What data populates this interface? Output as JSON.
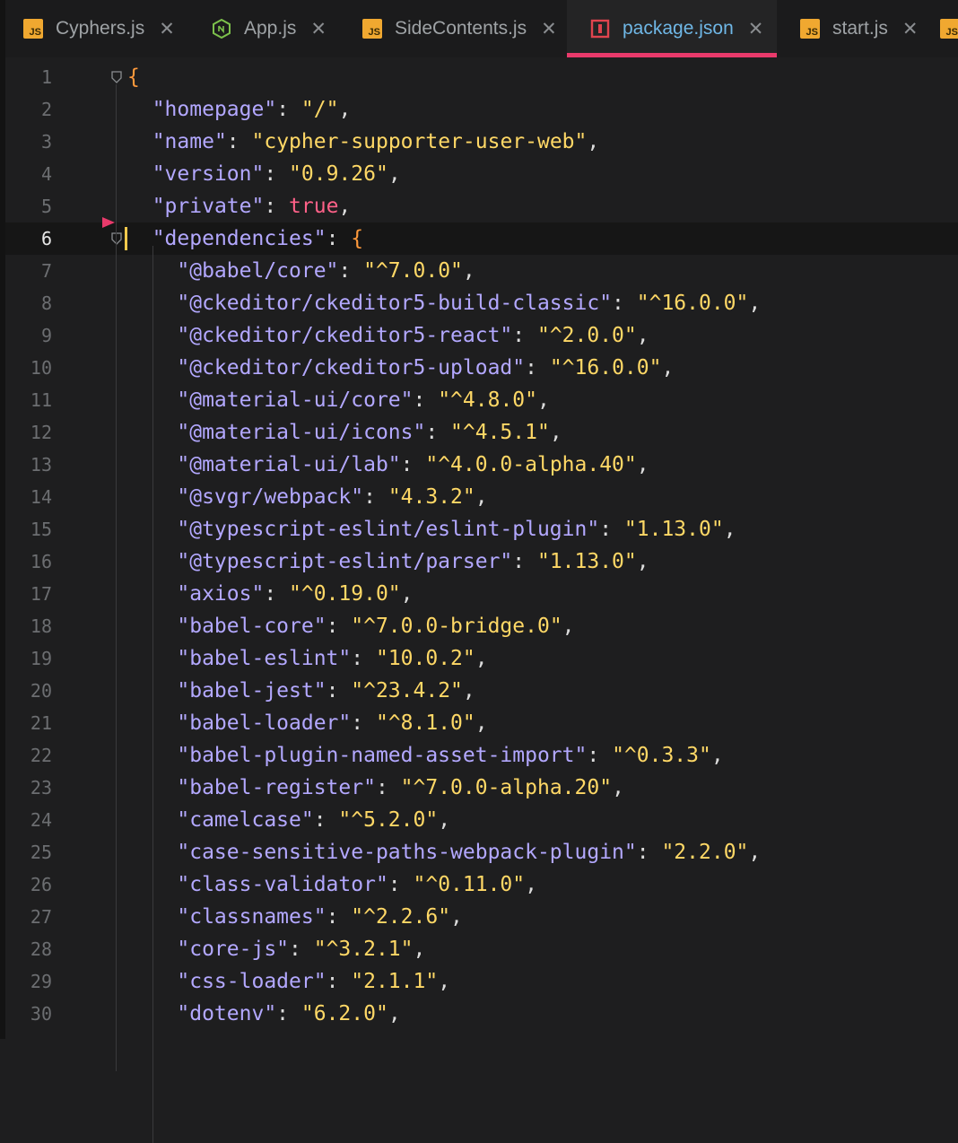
{
  "tabs": [
    {
      "label": "Cyphers.js",
      "icon": "js-icon",
      "active": false
    },
    {
      "label": "App.js",
      "icon": "nodejs-icon",
      "active": false
    },
    {
      "label": "SideContents.js",
      "icon": "js-icon",
      "active": false
    },
    {
      "label": "package.json",
      "icon": "npm-icon",
      "active": true
    },
    {
      "label": "start.js",
      "icon": "js-icon",
      "active": false
    }
  ],
  "close_glyph": "✕",
  "js_badge_text": "JS",
  "current_line": 6,
  "lines": [
    {
      "n": "1",
      "tokens": [
        {
          "t": "brace",
          "v": "{"
        }
      ]
    },
    {
      "n": "2",
      "tokens": [
        {
          "t": "ind",
          "v": "  "
        },
        {
          "t": "key",
          "v": "\"homepage\""
        },
        {
          "t": "punct",
          "v": ": "
        },
        {
          "t": "str",
          "v": "\"/\""
        },
        {
          "t": "punct",
          "v": ","
        }
      ]
    },
    {
      "n": "3",
      "tokens": [
        {
          "t": "ind",
          "v": "  "
        },
        {
          "t": "key",
          "v": "\"name\""
        },
        {
          "t": "punct",
          "v": ": "
        },
        {
          "t": "str",
          "v": "\"cypher-supporter-user-web\""
        },
        {
          "t": "punct",
          "v": ","
        }
      ]
    },
    {
      "n": "4",
      "tokens": [
        {
          "t": "ind",
          "v": "  "
        },
        {
          "t": "key",
          "v": "\"version\""
        },
        {
          "t": "punct",
          "v": ": "
        },
        {
          "t": "str",
          "v": "\"0.9.26\""
        },
        {
          "t": "punct",
          "v": ","
        }
      ]
    },
    {
      "n": "5",
      "tokens": [
        {
          "t": "ind",
          "v": "  "
        },
        {
          "t": "key",
          "v": "\"private\""
        },
        {
          "t": "punct",
          "v": ": "
        },
        {
          "t": "kw",
          "v": "true"
        },
        {
          "t": "punct",
          "v": ","
        }
      ]
    },
    {
      "n": "6",
      "tokens": [
        {
          "t": "ind",
          "v": "  "
        },
        {
          "t": "key",
          "v": "\"dependencies\""
        },
        {
          "t": "punct",
          "v": ": "
        },
        {
          "t": "brace",
          "v": "{"
        }
      ]
    },
    {
      "n": "7",
      "tokens": [
        {
          "t": "ind",
          "v": "    "
        },
        {
          "t": "key",
          "v": "\"@babel/core\""
        },
        {
          "t": "punct",
          "v": ": "
        },
        {
          "t": "str",
          "v": "\"^7.0.0\""
        },
        {
          "t": "punct",
          "v": ","
        }
      ]
    },
    {
      "n": "8",
      "tokens": [
        {
          "t": "ind",
          "v": "    "
        },
        {
          "t": "key",
          "v": "\"@ckeditor/ckeditor5-build-classic\""
        },
        {
          "t": "punct",
          "v": ": "
        },
        {
          "t": "str",
          "v": "\"^16.0.0\""
        },
        {
          "t": "punct",
          "v": ","
        }
      ]
    },
    {
      "n": "9",
      "tokens": [
        {
          "t": "ind",
          "v": "    "
        },
        {
          "t": "key",
          "v": "\"@ckeditor/ckeditor5-react\""
        },
        {
          "t": "punct",
          "v": ": "
        },
        {
          "t": "str",
          "v": "\"^2.0.0\""
        },
        {
          "t": "punct",
          "v": ","
        }
      ]
    },
    {
      "n": "10",
      "tokens": [
        {
          "t": "ind",
          "v": "    "
        },
        {
          "t": "key",
          "v": "\"@ckeditor/ckeditor5-upload\""
        },
        {
          "t": "punct",
          "v": ": "
        },
        {
          "t": "str",
          "v": "\"^16.0.0\""
        },
        {
          "t": "punct",
          "v": ","
        }
      ]
    },
    {
      "n": "11",
      "tokens": [
        {
          "t": "ind",
          "v": "    "
        },
        {
          "t": "key",
          "v": "\"@material-ui/core\""
        },
        {
          "t": "punct",
          "v": ": "
        },
        {
          "t": "str",
          "v": "\"^4.8.0\""
        },
        {
          "t": "punct",
          "v": ","
        }
      ]
    },
    {
      "n": "12",
      "tokens": [
        {
          "t": "ind",
          "v": "    "
        },
        {
          "t": "key",
          "v": "\"@material-ui/icons\""
        },
        {
          "t": "punct",
          "v": ": "
        },
        {
          "t": "str",
          "v": "\"^4.5.1\""
        },
        {
          "t": "punct",
          "v": ","
        }
      ]
    },
    {
      "n": "13",
      "tokens": [
        {
          "t": "ind",
          "v": "    "
        },
        {
          "t": "key",
          "v": "\"@material-ui/lab\""
        },
        {
          "t": "punct",
          "v": ": "
        },
        {
          "t": "str",
          "v": "\"^4.0.0-alpha.40\""
        },
        {
          "t": "punct",
          "v": ","
        }
      ]
    },
    {
      "n": "14",
      "tokens": [
        {
          "t": "ind",
          "v": "    "
        },
        {
          "t": "key",
          "v": "\"@svgr/webpack\""
        },
        {
          "t": "punct",
          "v": ": "
        },
        {
          "t": "str",
          "v": "\"4.3.2\""
        },
        {
          "t": "punct",
          "v": ","
        }
      ]
    },
    {
      "n": "15",
      "tokens": [
        {
          "t": "ind",
          "v": "    "
        },
        {
          "t": "key",
          "v": "\"@typescript-eslint/eslint-plugin\""
        },
        {
          "t": "punct",
          "v": ": "
        },
        {
          "t": "str",
          "v": "\"1.13.0\""
        },
        {
          "t": "punct",
          "v": ","
        }
      ]
    },
    {
      "n": "16",
      "tokens": [
        {
          "t": "ind",
          "v": "    "
        },
        {
          "t": "key",
          "v": "\"@typescript-eslint/parser\""
        },
        {
          "t": "punct",
          "v": ": "
        },
        {
          "t": "str",
          "v": "\"1.13.0\""
        },
        {
          "t": "punct",
          "v": ","
        }
      ]
    },
    {
      "n": "17",
      "tokens": [
        {
          "t": "ind",
          "v": "    "
        },
        {
          "t": "key",
          "v": "\"axios\""
        },
        {
          "t": "punct",
          "v": ": "
        },
        {
          "t": "str",
          "v": "\"^0.19.0\""
        },
        {
          "t": "punct",
          "v": ","
        }
      ]
    },
    {
      "n": "18",
      "tokens": [
        {
          "t": "ind",
          "v": "    "
        },
        {
          "t": "key",
          "v": "\"babel-core\""
        },
        {
          "t": "punct",
          "v": ": "
        },
        {
          "t": "str",
          "v": "\"^7.0.0-bridge.0\""
        },
        {
          "t": "punct",
          "v": ","
        }
      ]
    },
    {
      "n": "19",
      "tokens": [
        {
          "t": "ind",
          "v": "    "
        },
        {
          "t": "key",
          "v": "\"babel-eslint\""
        },
        {
          "t": "punct",
          "v": ": "
        },
        {
          "t": "str",
          "v": "\"10.0.2\""
        },
        {
          "t": "punct",
          "v": ","
        }
      ]
    },
    {
      "n": "20",
      "tokens": [
        {
          "t": "ind",
          "v": "    "
        },
        {
          "t": "key",
          "v": "\"babel-jest\""
        },
        {
          "t": "punct",
          "v": ": "
        },
        {
          "t": "str",
          "v": "\"^23.4.2\""
        },
        {
          "t": "punct",
          "v": ","
        }
      ]
    },
    {
      "n": "21",
      "tokens": [
        {
          "t": "ind",
          "v": "    "
        },
        {
          "t": "key",
          "v": "\"babel-loader\""
        },
        {
          "t": "punct",
          "v": ": "
        },
        {
          "t": "str",
          "v": "\"^8.1.0\""
        },
        {
          "t": "punct",
          "v": ","
        }
      ]
    },
    {
      "n": "22",
      "tokens": [
        {
          "t": "ind",
          "v": "    "
        },
        {
          "t": "key",
          "v": "\"babel-plugin-named-asset-import\""
        },
        {
          "t": "punct",
          "v": ": "
        },
        {
          "t": "str",
          "v": "\"^0.3.3\""
        },
        {
          "t": "punct",
          "v": ","
        }
      ]
    },
    {
      "n": "23",
      "tokens": [
        {
          "t": "ind",
          "v": "    "
        },
        {
          "t": "key",
          "v": "\"babel-register\""
        },
        {
          "t": "punct",
          "v": ": "
        },
        {
          "t": "str",
          "v": "\"^7.0.0-alpha.20\""
        },
        {
          "t": "punct",
          "v": ","
        }
      ]
    },
    {
      "n": "24",
      "tokens": [
        {
          "t": "ind",
          "v": "    "
        },
        {
          "t": "key",
          "v": "\"camelcase\""
        },
        {
          "t": "punct",
          "v": ": "
        },
        {
          "t": "str",
          "v": "\"^5.2.0\""
        },
        {
          "t": "punct",
          "v": ","
        }
      ]
    },
    {
      "n": "25",
      "tokens": [
        {
          "t": "ind",
          "v": "    "
        },
        {
          "t": "key",
          "v": "\"case-sensitive-paths-webpack-plugin\""
        },
        {
          "t": "punct",
          "v": ": "
        },
        {
          "t": "str",
          "v": "\"2.2.0\""
        },
        {
          "t": "punct",
          "v": ","
        }
      ]
    },
    {
      "n": "26",
      "tokens": [
        {
          "t": "ind",
          "v": "    "
        },
        {
          "t": "key",
          "v": "\"class-validator\""
        },
        {
          "t": "punct",
          "v": ": "
        },
        {
          "t": "str",
          "v": "\"^0.11.0\""
        },
        {
          "t": "punct",
          "v": ","
        }
      ]
    },
    {
      "n": "27",
      "tokens": [
        {
          "t": "ind",
          "v": "    "
        },
        {
          "t": "key",
          "v": "\"classnames\""
        },
        {
          "t": "punct",
          "v": ": "
        },
        {
          "t": "str",
          "v": "\"^2.2.6\""
        },
        {
          "t": "punct",
          "v": ","
        }
      ]
    },
    {
      "n": "28",
      "tokens": [
        {
          "t": "ind",
          "v": "    "
        },
        {
          "t": "key",
          "v": "\"core-js\""
        },
        {
          "t": "punct",
          "v": ": "
        },
        {
          "t": "str",
          "v": "\"^3.2.1\""
        },
        {
          "t": "punct",
          "v": ","
        }
      ]
    },
    {
      "n": "29",
      "tokens": [
        {
          "t": "ind",
          "v": "    "
        },
        {
          "t": "key",
          "v": "\"css-loader\""
        },
        {
          "t": "punct",
          "v": ": "
        },
        {
          "t": "str",
          "v": "\"2.1.1\""
        },
        {
          "t": "punct",
          "v": ","
        }
      ]
    },
    {
      "n": "30",
      "tokens": [
        {
          "t": "ind",
          "v": "    "
        },
        {
          "t": "key",
          "v": "\"dotenv\""
        },
        {
          "t": "punct",
          "v": ": "
        },
        {
          "t": "str",
          "v": "\"6.2.0\""
        },
        {
          "t": "punct",
          "v": ","
        }
      ]
    }
  ]
}
